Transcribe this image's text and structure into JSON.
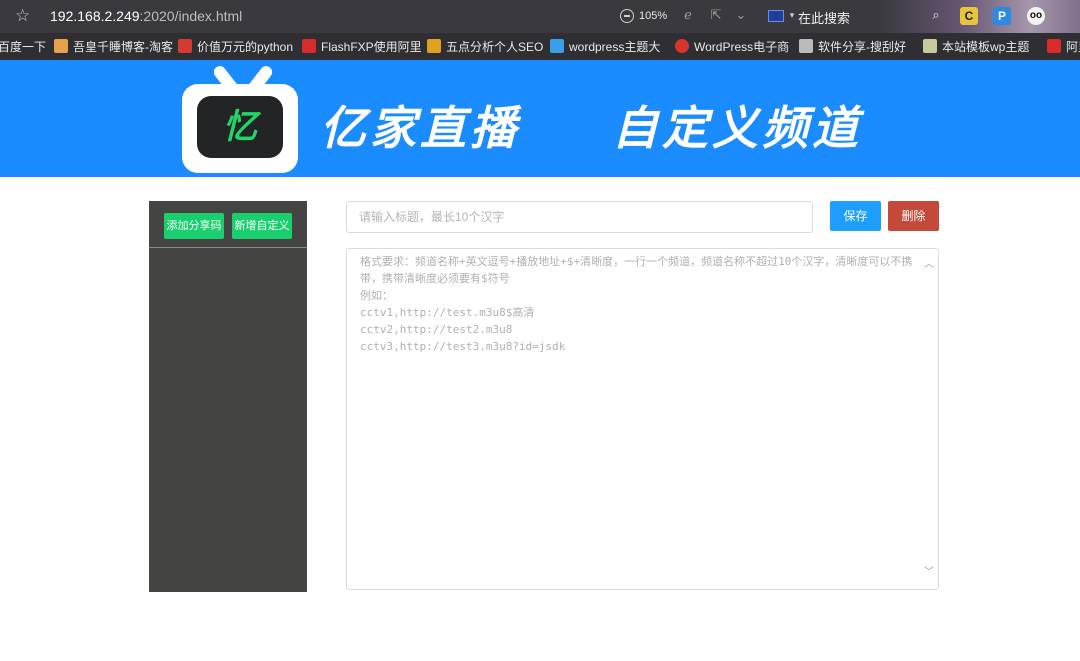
{
  "browser": {
    "url_host": "192.168.2.249",
    "url_rest": ":2020/index.html",
    "zoom": "105%",
    "search_label": "在此搜索",
    "extensions": [
      {
        "label": "C",
        "bg": "#e8c43a",
        "color": "#222222"
      },
      {
        "label": "P",
        "bg": "#2b8ae6",
        "color": "#ffffff"
      },
      {
        "label": "oo",
        "bg": "#f2f2f2",
        "color": "#111111"
      }
    ]
  },
  "bookmarks": [
    {
      "label": "百度一下",
      "color": "#3b6fd6"
    },
    {
      "label": "吾皇千睡博客-淘客",
      "color": "#e7a24b"
    },
    {
      "label": "价值万元的python",
      "color": "#d43a2e"
    },
    {
      "label": "FlashFXP使用阿里",
      "color": "#d82b2b"
    },
    {
      "label": "五点分析个人SEO",
      "color": "#e0a020"
    },
    {
      "label": "wordpress主题大",
      "color": "#3aa0e6"
    },
    {
      "label": "WordPress电子商",
      "color": "#d8342c"
    },
    {
      "label": "软件分享-搜刮好",
      "color": "#bbbbbb"
    },
    {
      "label": "本站模板wp主题",
      "color": "#c9c9a0"
    },
    {
      "label": "阿里",
      "color": "#d82b2b"
    }
  ],
  "banner": {
    "logo_text": "忆",
    "title": "亿家直播",
    "subtitle": "自定义频道",
    "bg_color": "#1a8cff"
  },
  "sidebar": {
    "add_share_code": "添加分享码",
    "new_custom": "新增自定义"
  },
  "form": {
    "title_placeholder": "请输入标题，最长10个汉字",
    "save_label": "保存",
    "delete_label": "删除",
    "content_placeholder": "格式要求：频道名称+英文逗号+播放地址+$+清晰度，一行一个频道，频道名称不超过10个汉字，清晰度可以不携带，携带清晰度必须要有$符号\n例如：\ncctv1,http://test.m3u8$高清\ncctv2,http://test2.m3u8\ncctv3,http://test3.m3u8?id=jsdk"
  },
  "colors": {
    "accent_green": "#1ad06e",
    "save_blue": "#1e9fff",
    "delete_red": "#c4493b",
    "sidebar_bg": "#444443"
  }
}
